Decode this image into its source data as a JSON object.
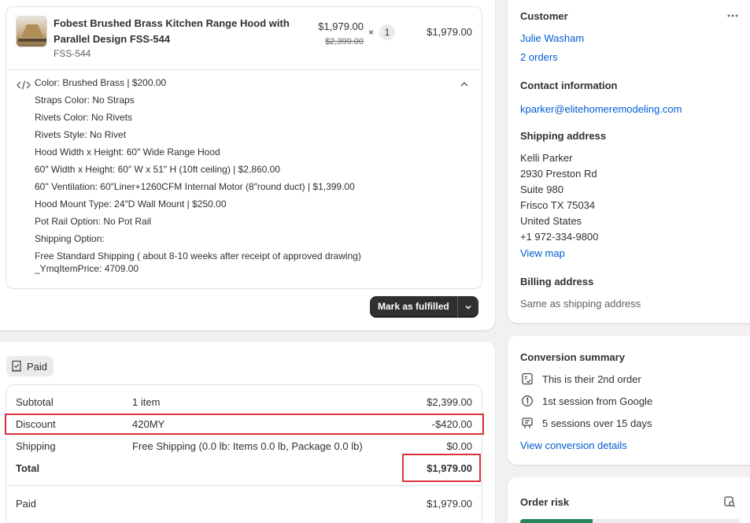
{
  "line_item": {
    "title": "Fobest Brushed Brass Kitchen Range Hood with Parallel Design FSS-544",
    "sku": "FSS-544",
    "price": "$1,979.00",
    "original_price": "$2,399.00",
    "times": "×",
    "quantity": "1",
    "total": "$1,979.00",
    "properties": [
      "Color: Brushed Brass | $200.00",
      "Straps Color: No Straps",
      "Rivets Color: No Rivets",
      "Rivets Style: No Rivet",
      "Hood Width x Height: 60″ Wide Range Hood",
      "60″ Width x Height: 60″ W x 51″ H (10ft ceiling) | $2,860.00",
      "60'' Ventilation: 60″Liner+1260CFM Internal Motor (8″round duct) | $1,399.00",
      "Hood Mount Type: 24″D Wall Mount | $250.00",
      "Pot Rail Option: No Pot Rail",
      "Shipping Option:",
      "Free Standard Shipping ( about 8-10 weeks after receipt of approved drawing) _YmqItemPrice: 4709.00"
    ],
    "fulfill_label": "Mark as fulfilled"
  },
  "payment": {
    "badge": "Paid",
    "subtotal": {
      "label": "Subtotal",
      "desc": "1 item",
      "value": "$2,399.00"
    },
    "discount": {
      "label": "Discount",
      "desc": "420MY",
      "value": "-$420.00"
    },
    "shipping": {
      "label": "Shipping",
      "desc": "Free Shipping (0.0 lb: Items 0.0 lb, Package 0.0 lb)",
      "value": "$0.00"
    },
    "total": {
      "label": "Total",
      "value": "$1,979.00"
    },
    "paid": {
      "label": "Paid",
      "value": "$1,979.00"
    }
  },
  "customer": {
    "heading": "Customer",
    "name": "Julie Washam",
    "orders": "2 orders",
    "contact_heading": "Contact information",
    "email": "kparker@elitehomeremodeling.com",
    "shipping_heading": "Shipping address",
    "address": [
      "Kelli Parker",
      "2930 Preston Rd",
      "Suite 980",
      "Frisco TX 75034",
      "United States",
      "+1 972-334-9800"
    ],
    "view_map": "View map",
    "billing_heading": "Billing address",
    "billing": "Same as shipping address"
  },
  "conversion": {
    "heading": "Conversion summary",
    "rows": [
      "This is their 2nd order",
      "1st session from Google",
      "5 sessions over 15 days"
    ],
    "link": "View conversion details"
  },
  "risk": {
    "heading": "Order risk",
    "level": 0.33
  },
  "colors": {
    "link": "#005bd3",
    "highlight": "#d9343d",
    "risk_low": "#29845a"
  }
}
